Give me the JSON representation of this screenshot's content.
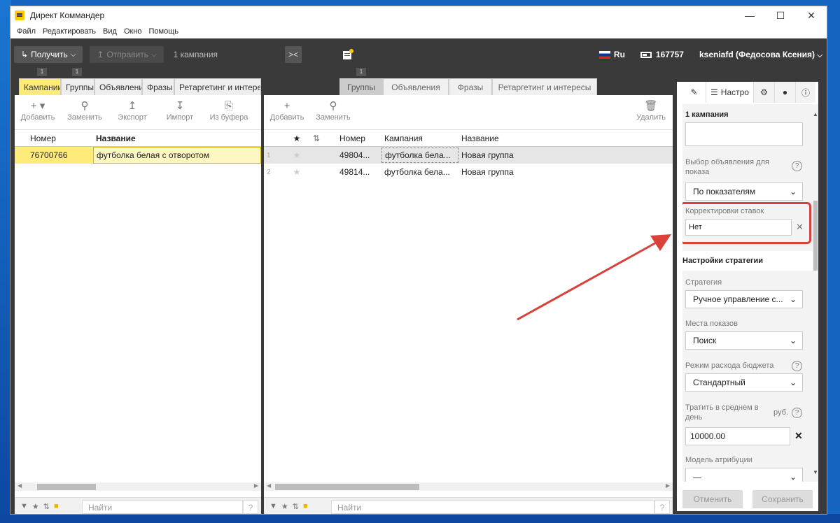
{
  "window": {
    "title": "Директ Коммандер"
  },
  "menu": [
    "Файл",
    "Редактировать",
    "Вид",
    "Окно",
    "Помощь"
  ],
  "toolbar": {
    "get_label": "Получить",
    "send_label": "Отправить",
    "campaign_count": "1 кампания",
    "lang": "Ru",
    "balance": "167757",
    "user": "kseniafd (Федосова Ксения)"
  },
  "left_panel": {
    "tabs": [
      "Кампании",
      "Группы",
      "Объявления",
      "Фразы",
      "Ретаргетинг и интересы"
    ],
    "badges": [
      "1",
      "1"
    ],
    "actions": [
      "Добавить",
      "Заменить",
      "Экспорт",
      "Импорт",
      "Из буфера"
    ],
    "columns": [
      "Номер",
      "Название"
    ],
    "rows": [
      {
        "number": "76700766",
        "name": "футболка белая с отворотом"
      }
    ],
    "search_placeholder": "Найти",
    "help": "?"
  },
  "mid_panel": {
    "tabs": [
      "Группы",
      "Объявления",
      "Фразы",
      "Ретаргетинг и интересы"
    ],
    "badge": "1",
    "actions": [
      "Добавить",
      "Заменить"
    ],
    "delete_label": "Удалить",
    "columns": [
      "Номер",
      "Кампания",
      "Название"
    ],
    "rows": [
      {
        "idx": "1",
        "number": "49804...",
        "campaign": "футболка бела...",
        "name": "Новая группа"
      },
      {
        "idx": "2",
        "number": "49814...",
        "campaign": "футболка бела...",
        "name": "Новая группа"
      }
    ],
    "search_placeholder": "Найти",
    "help": "?"
  },
  "right_panel": {
    "settings_tab": "Настро",
    "header": "1 кампания",
    "ad_choice_label": "Выбор объявления для показа",
    "ad_choice_value": "По показателям",
    "bid_adj_label": "Корректировки ставок",
    "bid_adj_value": "Нет",
    "strategy_section": "Настройки стратегии",
    "strategy_label": "Стратегия",
    "strategy_value": "Ручное управление с...",
    "places_label": "Места показов",
    "places_value": "Поиск",
    "budget_mode_label": "Режим расхода бюджета",
    "budget_mode_value": "Стандартный",
    "daily_label": "Тратить в среднем в день",
    "daily_unit": "руб.",
    "daily_value": "10000.00",
    "attribution_label": "Модель атрибуции",
    "attribution_value": "—",
    "cancel_label": "Отменить",
    "save_label": "Сохранить",
    "help": "?"
  },
  "colors": {
    "accent_yellow": "#ffeb7a",
    "toolbar_bg": "#3a3a3a",
    "highlight_red": "#d9413a"
  }
}
